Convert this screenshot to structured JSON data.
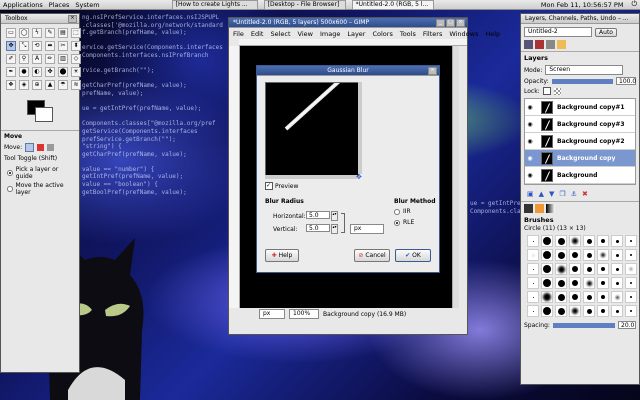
{
  "top_panel": {
    "menus": [
      "Applications",
      "Places",
      "System"
    ],
    "tasks": [
      "[How to create Lights ...",
      "[Desktop - File Browser]",
      "*Untitled-2.0 (RGB, 5 l..."
    ],
    "clock": "Mon Feb 11, 10:56:57 PM"
  },
  "toolbox": {
    "title": "Toolbox",
    "tool_options_title": "Move",
    "move_label": "Move:",
    "tool_toggle": "Tool Toggle (Shift)",
    "options": [
      "Pick a layer or guide",
      "Move the active layer"
    ]
  },
  "image_window": {
    "title": "*Untitled-2.0 (RGB, 5 layers) 500x600 – GIMP",
    "menus": [
      "File",
      "Edit",
      "Select",
      "View",
      "Image",
      "Layer",
      "Colors",
      "Tools",
      "Filters",
      "Windows",
      "Help"
    ],
    "unit": "px",
    "zoom": "100%",
    "status": "Background copy (16.9 MB)"
  },
  "blur_dialog": {
    "title": "Gaussian Blur",
    "preview_label": "Preview",
    "blur_radius_label": "Blur Radius",
    "horizontal_label": "Horizontal:",
    "horizontal_value": "5.0",
    "vertical_label": "Vertical:",
    "vertical_value": "5.0",
    "unit": "px",
    "blur_method_label": "Blur Method",
    "methods": [
      "IIR",
      "RLE"
    ],
    "help_label": "Help",
    "cancel_label": "Cancel",
    "ok_label": "OK"
  },
  "layers_panel": {
    "title": "Layers, Channels, Paths, Undo – ...",
    "image_combo": "Untitled-2",
    "auto_label": "Auto",
    "section": "Layers",
    "mode_label": "Mode:",
    "mode_value": "Screen",
    "opacity_label": "Opacity:",
    "opacity_value": "100.0",
    "lock_label": "Lock:",
    "layers": [
      "Background copy#1",
      "Background copy#3",
      "Background copy#2",
      "Background copy",
      "Background"
    ],
    "selected_index": 3,
    "brushes_title": "Brushes",
    "brush_name": "Circle (11) (13 × 13)",
    "spacing_label": "Spacing:",
    "spacing_value": "20.0"
  },
  "desktop_code": [
    "ng.nsIPrefService.interfaces.nsIJSPUPL",
    ".classes['@mozilla.org/network/standard",
    "f.getBranch(prefHame, value);",
    "",
    "ervice.getService(Components.interfaces",
    "Components.interfaces.nsIPrefBranch",
    "",
    "rvice.getBranch(\"\");",
    "",
    "getCharPref(prefName, value);",
    "prefName, value);",
    "",
    "ue = getIntPref(prefName, value);",
    "",
    "Components.classes[\"@mozilla.org/pref",
    "getService(Components.interfaces",
    "prefService.getBranch(\"\");",
    "\"string\") {",
    "getCharPref(prefName, value);",
    "",
    "value == \"number\") {",
    "getIntPref(prefName, value);",
    "value == \"boolean\") {",
    "getBoolPref(prefName, value);"
  ]
}
